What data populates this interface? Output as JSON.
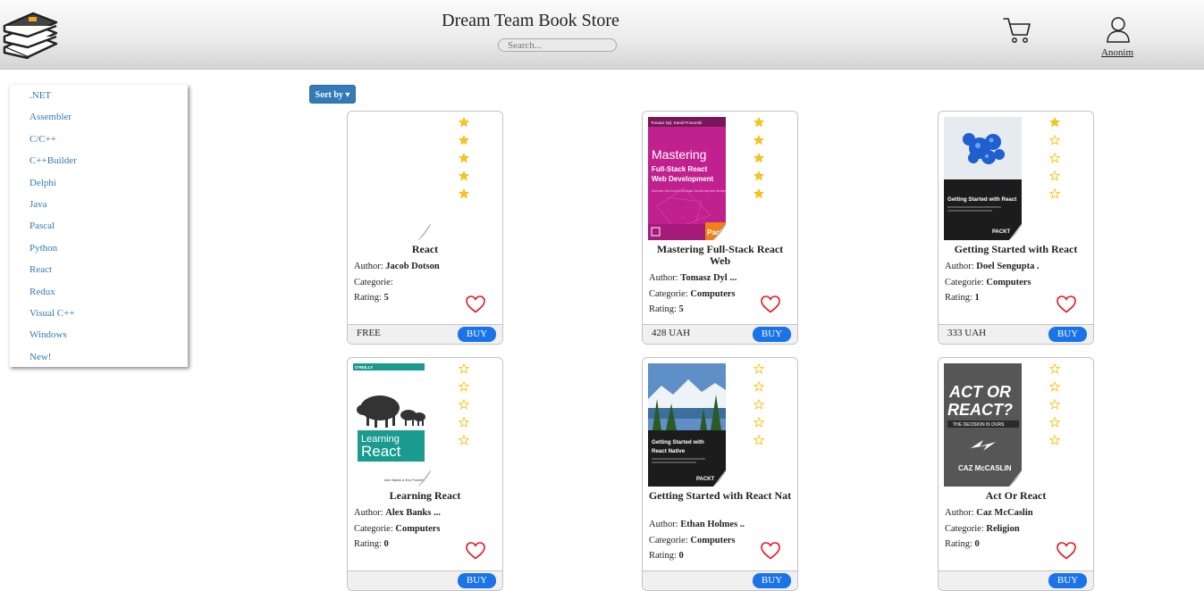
{
  "header": {
    "title": "Dream Team Book Store",
    "search_placeholder": "Search...",
    "user_label": "Anonim"
  },
  "sidebar": {
    "items": [
      ".NET",
      "Assembler",
      "C/C++",
      "C++Builder",
      "Delphi",
      "Java",
      "Pascal",
      "Python",
      "React",
      "Redux",
      "Visual C++",
      "Windows",
      "New!"
    ]
  },
  "toolbar": {
    "sort_label": "Sort by ▾"
  },
  "labels": {
    "author": "Author: ",
    "category": "Categorie: ",
    "rating": "Rating: ",
    "buy": "BUY"
  },
  "books": [
    {
      "title": "React",
      "author": "Jacob Dotson",
      "category": "",
      "rating": "5",
      "stars_filled": 5,
      "price": "FREE",
      "cover": "none"
    },
    {
      "title": "Mastering Full-Stack React Web",
      "author": "Tomasz Dyl ...",
      "category": "Computers",
      "rating": "5",
      "stars_filled": 5,
      "price": "428 UAH",
      "cover": "mastering",
      "cover_text": {
        "top": "Tomasz Dyl, Kamil Przeorski",
        "main1": "Mastering",
        "main2": "Full-Stack React",
        "main3": "Web Development",
        "sub": "Discover end-to-end full-stack JavaScript web development",
        "brand": "Pack"
      }
    },
    {
      "title": "Getting Started with React",
      "author": "Doel Sengupta .",
      "category": "Computers",
      "rating": "1",
      "stars_filled": 1,
      "price": "333 UAH",
      "cover": "gsreact",
      "cover_text": {
        "main": "Getting Started with React",
        "brand": "PACKT"
      }
    },
    {
      "title": "Learning React",
      "author": "Alex Banks ...",
      "category": "Computers",
      "rating": "0",
      "stars_filled": 0,
      "price": "",
      "cover": "learning",
      "cover_text": {
        "brand": "O'REILLY",
        "main1": "Learning",
        "main2": "React",
        "authors": "Alex Banks & Eve Porcello"
      }
    },
    {
      "title": "Getting Started with React Nat",
      "author": "Ethan Holmes ..",
      "category": "Computers",
      "rating": "0",
      "stars_filled": 0,
      "price": "",
      "cover": "native",
      "cover_text": {
        "main1": "Getting Started with",
        "main2": "React Native",
        "brand": "PACKT"
      }
    },
    {
      "title": "Act Or React",
      "author": "Caz McCaslin",
      "category": "Religion",
      "rating": "0",
      "stars_filled": 0,
      "price": "",
      "cover": "actreact",
      "cover_text": {
        "main1": "ACT OR",
        "main2": "REACT?",
        "sub": "THE DECISION IS OURS",
        "author": "CAZ McCASLIN"
      }
    }
  ],
  "colors": {
    "accent": "#337ab7",
    "buy": "#1a73e8",
    "star": "#f5c518",
    "heart": "#e3161f"
  }
}
